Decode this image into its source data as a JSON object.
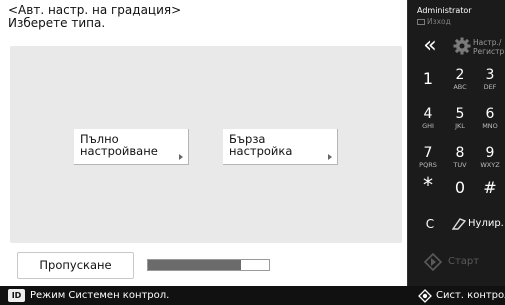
{
  "header": {
    "title": "<Авт. настр. на градация>",
    "subtitle": "Изберете типа."
  },
  "choices": {
    "full": {
      "line1": "Пълно",
      "line2": "настройване"
    },
    "quick": {
      "line1": "Бърза",
      "line2": "настройка"
    }
  },
  "skip_label": "Пропускане",
  "progress": {
    "value_fraction": 0.77
  },
  "status_bar": {
    "id_icon_label": "ID",
    "text": "Режим Системен контрол.",
    "system_monitor": "Сист. контрол"
  },
  "keypad": {
    "admin": "Administrator",
    "logout": "Изход",
    "back_glyph": "«",
    "settings_line1": "Настр./",
    "settings_line2": "Регистр.",
    "keys": [
      {
        "num": "1",
        "letters": ""
      },
      {
        "num": "2",
        "letters": "ABC"
      },
      {
        "num": "3",
        "letters": "DEF"
      },
      {
        "num": "4",
        "letters": "GHI"
      },
      {
        "num": "5",
        "letters": "JKL"
      },
      {
        "num": "6",
        "letters": "MNO"
      },
      {
        "num": "7",
        "letters": "PQRS"
      },
      {
        "num": "8",
        "letters": "TUV"
      },
      {
        "num": "9",
        "letters": "WXYZ"
      },
      {
        "num": "*",
        "letters": ""
      },
      {
        "num": "0",
        "letters": ""
      },
      {
        "num": "#",
        "letters": ""
      }
    ],
    "clear": "C",
    "reset": "Нулир.",
    "start": "Старт"
  },
  "colors": {
    "background": "#000000",
    "panel": "#1b1b1b",
    "content_area": "#e9e9e9",
    "progress_fill": "#6b6b6b",
    "start_disabled": "#5a5a5a"
  },
  "icons": [
    "back-icon",
    "gear-icon",
    "logout-icon",
    "reset-icon",
    "start-diamond-icon",
    "system-monitor-icon",
    "id-icon",
    "chevron-right-icon"
  ]
}
